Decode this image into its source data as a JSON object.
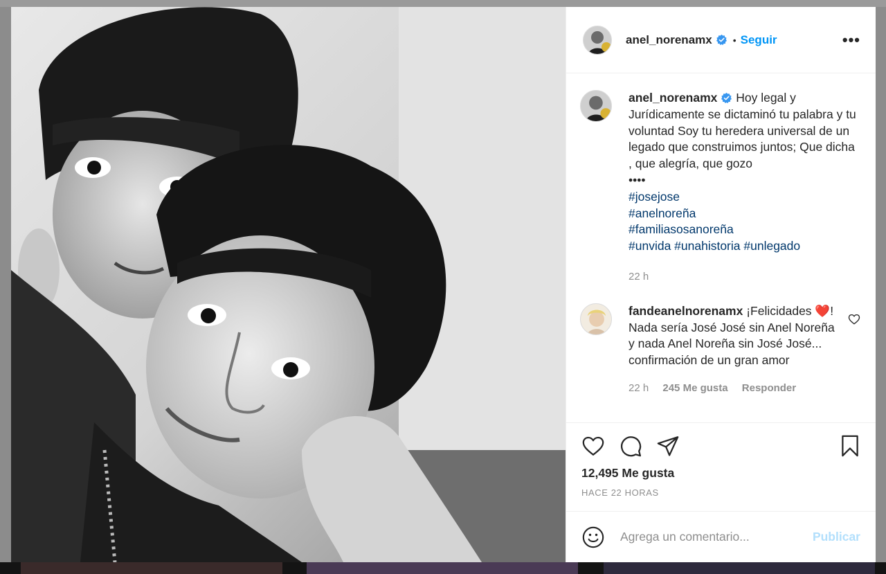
{
  "post": {
    "username": "anel_norenamx",
    "follow_label": "Seguir",
    "separator": "•",
    "more_label": "•••",
    "photo_icon": "photo-black-white-couple"
  },
  "caption": {
    "username": "anel_norenamx",
    "text": "Hoy legal y Jurídicamente se dictaminó tu palabra y tu voluntad Soy tu heredera universal de un legado que construimos juntos; Que dicha , que alegría, que gozo\n••••",
    "hashtags": [
      "#josejose",
      "#anelnoreña",
      "#familiasosanoreña",
      "#unvida #unahistoria #unlegado"
    ],
    "time": "22 h"
  },
  "comment": {
    "username": "fandeanelnorenamx",
    "text_before_heart": "¡Felicidades ",
    "heart": "❤️",
    "text_after_heart": "! Nada sería José José sin Anel Noreña y nada Anel Noreña sin José José... confirmación de un gran amor",
    "time": "22 h",
    "likes": "245 Me gusta",
    "reply_label": "Responder"
  },
  "actions": {
    "like_icon": "heart-outline-icon",
    "comment_icon": "comment-bubble-icon",
    "share_icon": "paper-plane-icon",
    "save_icon": "bookmark-icon",
    "likes_count": "12,495 Me gusta",
    "timestamp": "HACE 22 HORAS"
  },
  "add_comment": {
    "placeholder": "Agrega un comentario...",
    "publish_label": "Publicar",
    "emoji_icon": "smiley-face-icon"
  },
  "colors": {
    "link_blue": "#0095f6",
    "hashtag_blue": "#00376b",
    "verified_blue": "#3897f0",
    "muted_gray": "#8e8e8e",
    "publish_disabled": "#b2dffc"
  }
}
